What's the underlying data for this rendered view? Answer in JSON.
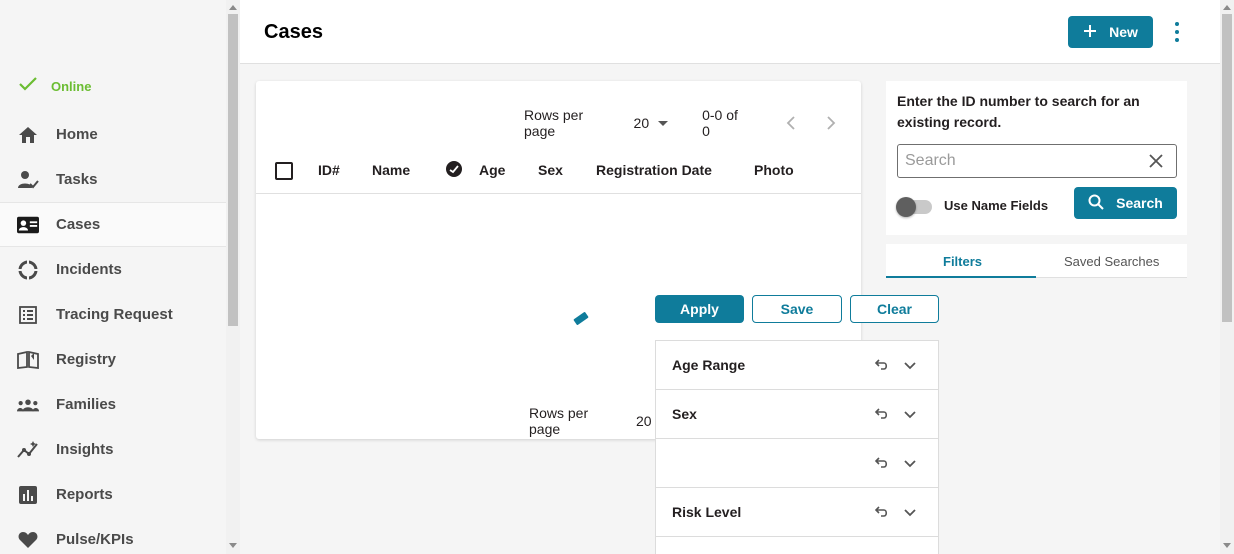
{
  "sidebar": {
    "status": {
      "label": "Online",
      "icon": "check-icon",
      "color": "#6bbd32"
    },
    "items": [
      {
        "label": "Home",
        "icon": "home-icon"
      },
      {
        "label": "Tasks",
        "icon": "tasks-icon"
      },
      {
        "label": "Cases",
        "icon": "cases-icon",
        "active": true
      },
      {
        "label": "Incidents",
        "icon": "incidents-icon"
      },
      {
        "label": "Tracing Request",
        "icon": "tracing-request-icon"
      },
      {
        "label": "Registry",
        "icon": "registry-icon"
      },
      {
        "label": "Families",
        "icon": "families-icon"
      },
      {
        "label": "Insights",
        "icon": "insights-icon"
      },
      {
        "label": "Reports",
        "icon": "reports-icon"
      },
      {
        "label": "Pulse/KPIs",
        "icon": "heart-icon"
      }
    ]
  },
  "header": {
    "title": "Cases",
    "new_label": "New",
    "accent": "#0f7c9b"
  },
  "table": {
    "rows_per_page_label": "Rows per page",
    "rows_per_page_value": "20",
    "range_text": "0-0 of 0",
    "columns": [
      "ID#",
      "Name",
      "Age",
      "Sex",
      "Registration Date",
      "Photo"
    ]
  },
  "search": {
    "title": "Enter the ID number to search for an existing record.",
    "placeholder": "Search",
    "toggle_label": "Use Name Fields",
    "button_label": "Search"
  },
  "tabs": [
    "Filters",
    "Saved Searches"
  ],
  "filter_actions": {
    "apply": "Apply",
    "save": "Save",
    "clear": "Clear"
  },
  "filters": [
    {
      "label": "Age Range"
    },
    {
      "label": "Sex"
    },
    {
      "label": ""
    },
    {
      "label": "Risk Level"
    }
  ]
}
